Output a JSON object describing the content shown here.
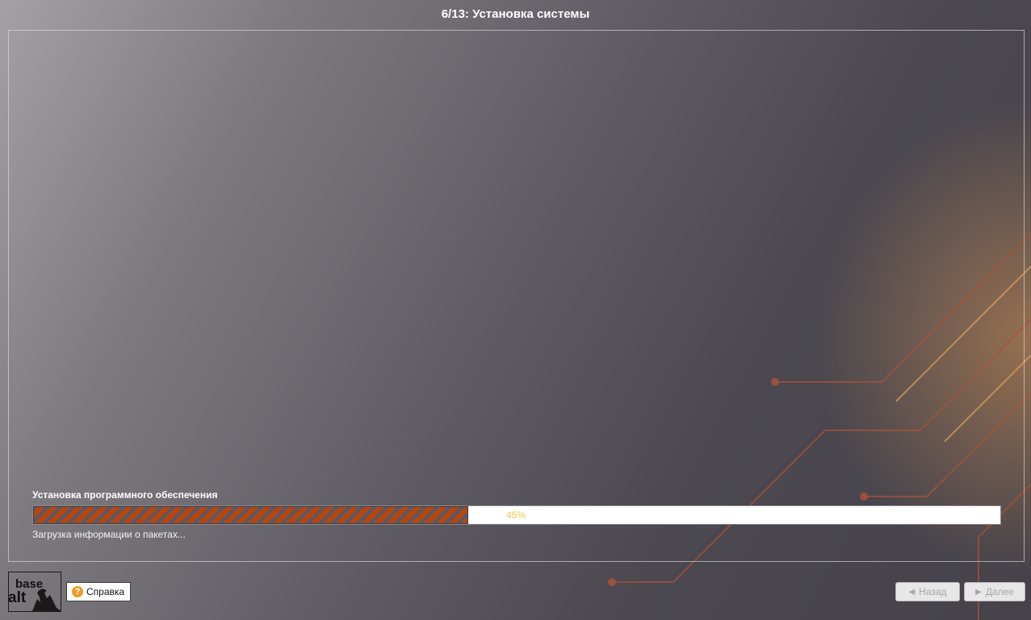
{
  "window": {
    "title": "6/13: Установка системы"
  },
  "install": {
    "section_label": "Установка программного обеспечения",
    "progress": 0.45,
    "progress_text": "45%",
    "status": "Загрузка информации о пакетах..."
  },
  "logo": {
    "line1": "base",
    "line2": "alt"
  },
  "footer": {
    "help_label": "Справка",
    "help_icon": "question-circle-icon",
    "back_label": "Назад",
    "back_icon": "chevron-left-icon",
    "next_label": "Далее",
    "next_icon": "chevron-right-icon"
  },
  "colors": {
    "progress_fill": "#b4460e",
    "progress_stripe": "#545a6c",
    "progress_text": "#f2c84b",
    "accent": "#ef9a2a"
  }
}
